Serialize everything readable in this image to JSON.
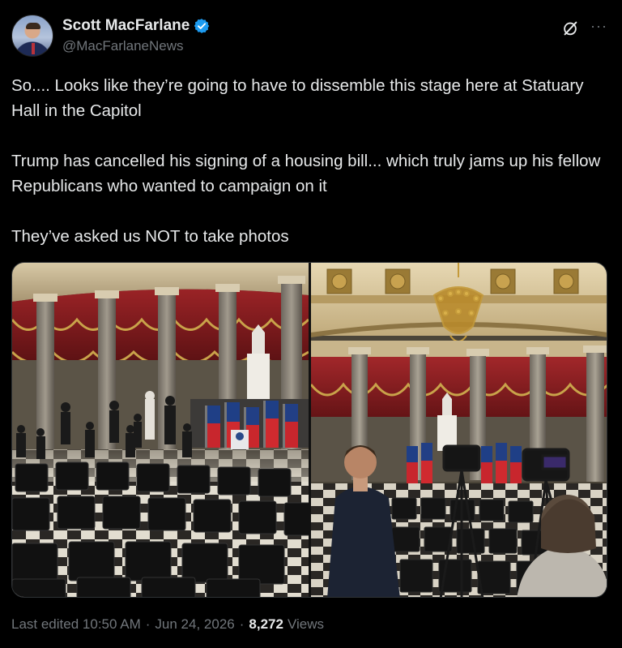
{
  "author": {
    "display_name": "Scott MacFarlane",
    "handle": "@MacFarlaneNews",
    "verified": true,
    "verified_color": "#1d9bf0"
  },
  "header_icons": [
    "grok-icon",
    "more-icon"
  ],
  "more_glyph": "···",
  "tweet": {
    "paragraphs": [
      "So.... Looks like they’re going to have to dissemble this stage here at Statuary Hall in the Capitol",
      "Trump has cancelled his signing of a housing bill... which truly jams up his fellow Republicans who wanted to campaign on it",
      "They’ve asked us NOT to take photos"
    ]
  },
  "media": {
    "count": 2
  },
  "meta": {
    "edited_label": "Last edited",
    "time": "10:50 AM",
    "date": "Jun 24, 2026",
    "separator": "·",
    "views_count": "8,272",
    "views_label": "Views"
  },
  "colors": {
    "background": "#000000",
    "text": "#e7e9ea",
    "secondary_text": "#71767b",
    "drapery_red": "#8f1f22",
    "drapery_gold": "#c9a34a"
  }
}
